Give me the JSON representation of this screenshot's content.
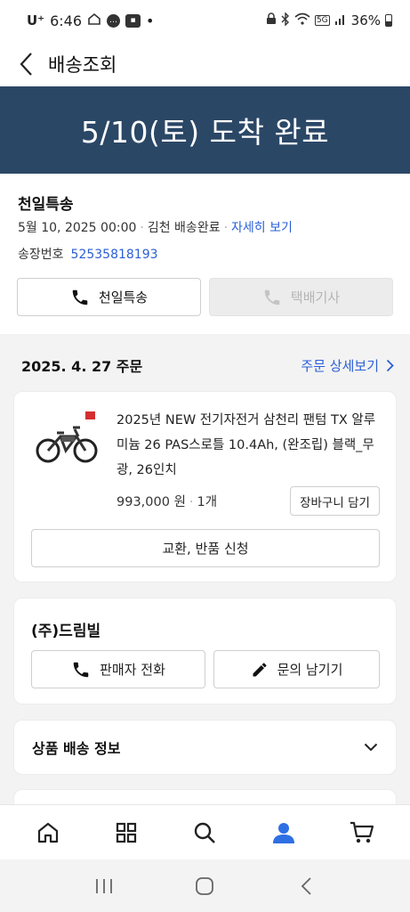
{
  "status_bar": {
    "carrier": "U⁺",
    "time": "6:46",
    "battery": "36%"
  },
  "header": {
    "title": "배송조회"
  },
  "banner": {
    "text": "5/10(토) 도착 완료"
  },
  "shipping": {
    "courier": "천일특송",
    "datetime": "5월 10, 2025 00:00",
    "location_status": "김천 배송완료",
    "detail_link": "자세히 보기",
    "invoice_label": "송장번호",
    "invoice_number": "52535818193",
    "courier_button": "천일특송",
    "driver_button": "택배기사"
  },
  "order": {
    "date": "2025. 4. 27 주문",
    "detail_link": "주문 상세보기"
  },
  "product": {
    "name": "2025년 NEW 전기자전거 삼천리 팬텀 TX 알루미늄 26 PAS스로틀 10.4Ah, (완조립) 블랙_무광, 26인치",
    "price": "993,000 원",
    "quantity": "1개",
    "cart_button": "장바구니 담기",
    "return_button": "교환, 반품 신청"
  },
  "seller": {
    "name": "(주)드림빌",
    "call_button": "판매자 전화",
    "inquiry_button": "문의 남기기"
  },
  "info": {
    "title": "상품 배송 정보"
  },
  "colors": {
    "banner": "#2b4766",
    "link": "#2a5fd6",
    "active_tab": "#2f6fe4"
  },
  "tabs": [
    "home-icon",
    "grid-icon",
    "search-icon",
    "user-icon",
    "cart-icon"
  ],
  "active_tab": "user-icon"
}
